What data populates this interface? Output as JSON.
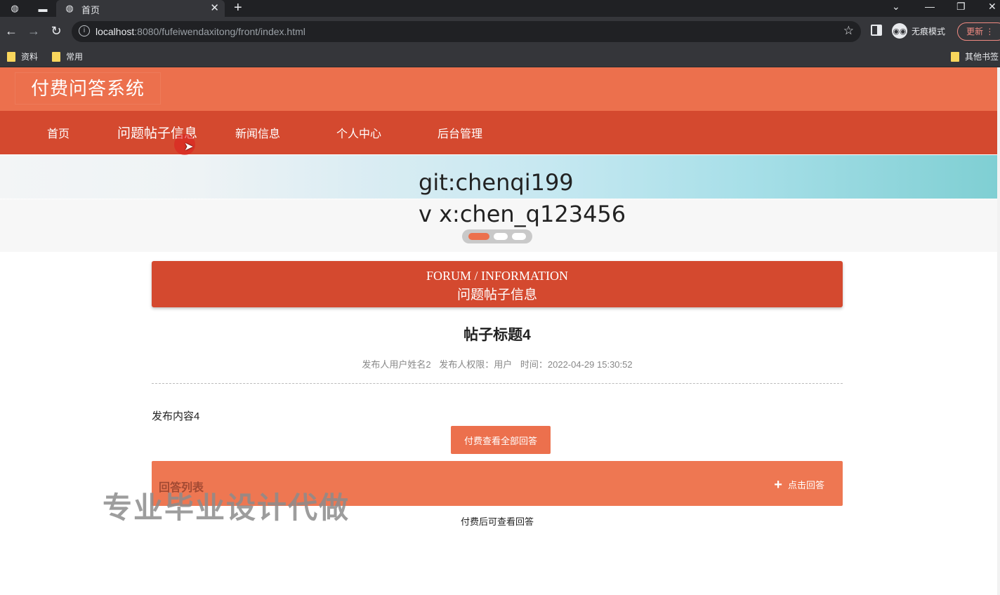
{
  "browser": {
    "tab_title": "首页",
    "url_host": "localhost",
    "url_rest": ":8080/fufeiwendaxitong/front/index.html",
    "incognito_label": "无痕模式",
    "update_label": "更新",
    "bookmarks": [
      "资料",
      "常用"
    ],
    "other_bookmarks": "其他书签"
  },
  "site": {
    "logo": "付费问答系统",
    "nav": [
      "首页",
      "问题帖子信息",
      "新闻信息",
      "个人中心",
      "后台管理"
    ]
  },
  "banner": {
    "line1": "git:chenqi199",
    "line2": "v x:chen_q123456"
  },
  "section": {
    "en": "FORUM / INFORMATION",
    "zh": "问题帖子信息"
  },
  "post": {
    "title": "帖子标题4",
    "author": "发布人用户姓名2",
    "role": "发布人权限：用户",
    "time": "时间：2022-04-29 15:30:52",
    "content": "发布内容4",
    "pay_button": "付费查看全部回答"
  },
  "answers": {
    "label": "回答列表",
    "reply_button": "点击回答",
    "hint": "付费后可查看回答"
  },
  "watermark": "专业毕业设计代做",
  "colors": {
    "header": "#ec704d",
    "nav": "#d4492f",
    "accent": "#ee7752"
  }
}
